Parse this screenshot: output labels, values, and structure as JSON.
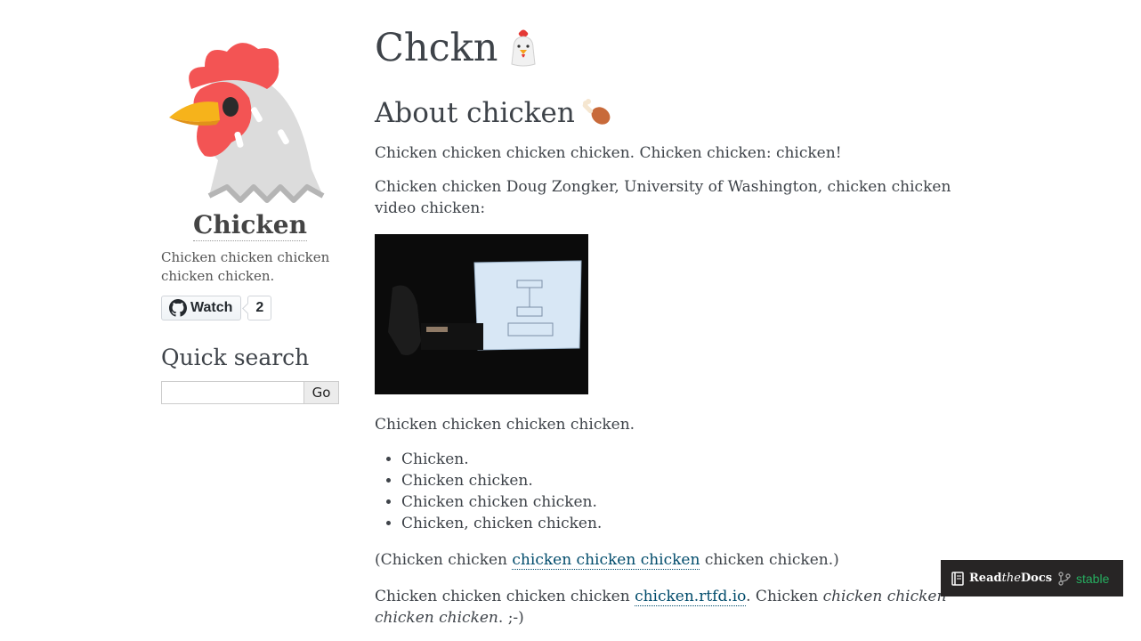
{
  "sidebar": {
    "title": "Chicken",
    "blurb": "Chicken chicken chicken chicken chicken.",
    "github": {
      "watch_label": "Watch",
      "watch_count": "2"
    },
    "quick_search": {
      "heading": "Quick search",
      "go_label": "Go",
      "value": ""
    }
  },
  "main": {
    "title": "Chckn",
    "section_heading": "About chicken",
    "para1": "Chicken chicken chicken chicken. Chicken chicken: chicken!",
    "para2": "Chicken chicken Doug Zongker, University of Washington, chicken chicken video chicken:",
    "para3": "Chicken chicken chicken chicken.",
    "list": [
      "Chicken.",
      "Chicken chicken.",
      "Chicken chicken chicken.",
      "Chicken, chicken chicken."
    ],
    "para4": {
      "pre": "(Chicken chicken ",
      "link": "chicken chicken chicken",
      "post": " chicken chicken.)"
    },
    "para5": {
      "pre": "Chicken chicken chicken chicken ",
      "link": "chicken.rtfd.io",
      "mid": ". Chicken ",
      "em": "chicken chicken chicken chicken",
      "post": ". ;-)"
    }
  },
  "rtd_badge": {
    "brand_read": "Read",
    "brand_the": "the",
    "brand_docs": "Docs",
    "version": "stable"
  },
  "colors": {
    "link": "#004b6b",
    "text": "#3e4349",
    "rtd_bg": "#272525",
    "rtd_version": "#27ae60",
    "comb": "#f35454"
  }
}
